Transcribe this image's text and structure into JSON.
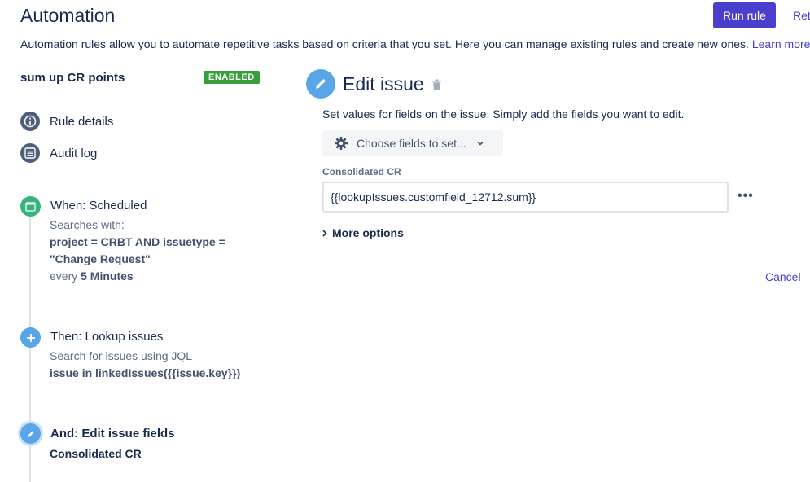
{
  "header": {
    "title": "Automation",
    "run_rule_label": "Run rule",
    "cut_link": "Ret",
    "description": "Automation rules allow you to automate repetitive tasks based on criteria that you set. Here you can manage existing rules and create new ones.",
    "learn_more": "Learn more"
  },
  "rule": {
    "name": "sum up CR points",
    "status": "ENABLED",
    "status_color": "#36a03a"
  },
  "nav": {
    "rule_details": "Rule details",
    "audit_log": "Audit log"
  },
  "steps": {
    "trigger": {
      "title": "When: Scheduled",
      "line1": "Searches with:",
      "jql_line1": "project = CRBT AND issuetype =",
      "jql_line2": "\"Change Request\"",
      "every": "every",
      "interval": "5 Minutes",
      "icon": "calendar-icon",
      "color": "#36b37e"
    },
    "lookup": {
      "title": "Then: Lookup issues",
      "line1": "Search for issues using JQL",
      "jql": "issue in linkedIssues({{issue.key}})",
      "icon": "plus-icon",
      "color": "#5aa5e8"
    },
    "edit": {
      "title": "And: Edit issue fields",
      "field": "Consolidated CR",
      "icon": "pencil-icon",
      "color": "#5aa5e8"
    }
  },
  "panel": {
    "title": "Edit issue",
    "description": "Set values for fields on the issue. Simply add the fields you want to edit.",
    "choose_fields": "Choose fields to set...",
    "field_label": "Consolidated CR",
    "field_value": "{{lookupIssues.customfield_12712.sum}}",
    "more_options": "More options",
    "cancel": "Cancel"
  },
  "colors": {
    "primary": "#4a3fcc",
    "accent_blue": "#5aa5e8"
  }
}
